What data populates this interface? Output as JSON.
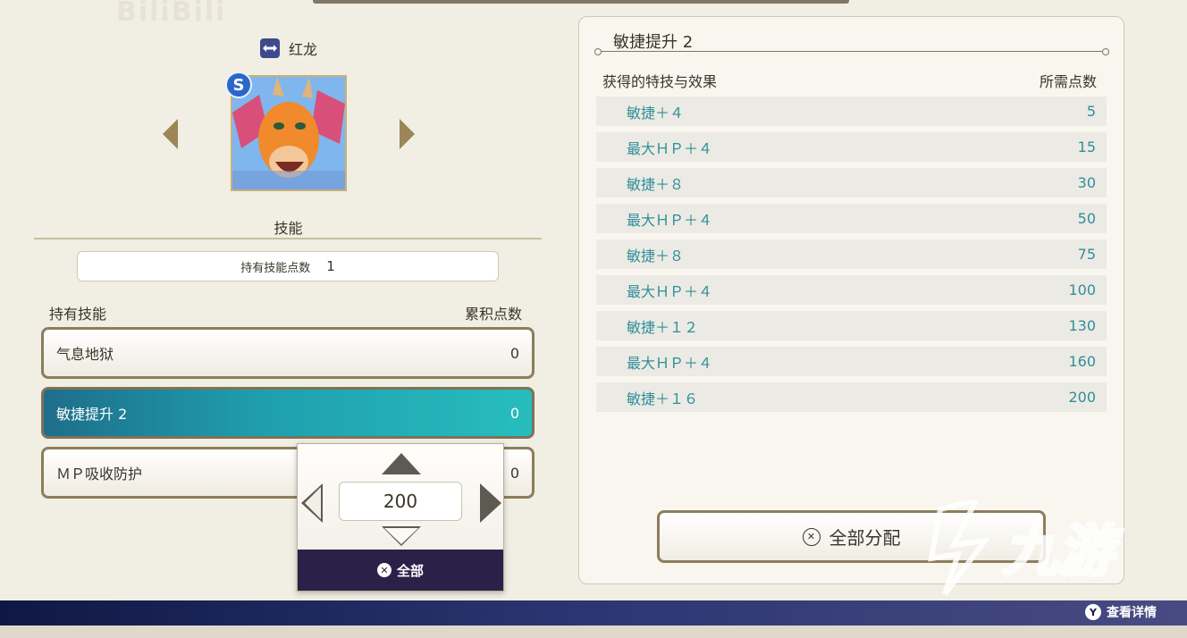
{
  "watermark_top": "BiliBili",
  "character": {
    "name": "红龙",
    "rank": "S"
  },
  "skills_section": {
    "heading": "技能",
    "points_label": "持有技能点数",
    "points_value": "1",
    "list_header_left": "持有技能",
    "list_header_right": "累积点数",
    "skills": [
      {
        "name": "气息地狱",
        "points": "0"
      },
      {
        "name": "敏捷提升 2",
        "points": "0"
      },
      {
        "name": "ＭＰ吸收防护",
        "points": "0"
      }
    ]
  },
  "quantity_popup": {
    "value": "200",
    "all_label": "全部",
    "button_glyph": "✕"
  },
  "detail_panel": {
    "title": "敏捷提升 2",
    "header_left": "获得的特技与效果",
    "header_right": "所需点数",
    "effects": [
      {
        "effect": "敏捷＋４",
        "cost": "5"
      },
      {
        "effect": "最大ＨＰ＋４",
        "cost": "15"
      },
      {
        "effect": "敏捷＋８",
        "cost": "30"
      },
      {
        "effect": "最大ＨＰ＋４",
        "cost": "50"
      },
      {
        "effect": "敏捷＋８",
        "cost": "75"
      },
      {
        "effect": "最大ＨＰ＋４",
        "cost": "100"
      },
      {
        "effect": "敏捷＋１２",
        "cost": "130"
      },
      {
        "effect": "最大ＨＰ＋４",
        "cost": "160"
      },
      {
        "effect": "敏捷＋１６",
        "cost": "200"
      }
    ],
    "assign_all_label": "全部分配",
    "assign_glyph": "✕"
  },
  "footer": {
    "hint_button": "Y",
    "hint_label": "查看详情"
  },
  "site_watermark": "九游",
  "colors": {
    "accent_teal": "#1f9fae",
    "effect_text": "#2f8f9a",
    "footer_bg": "#0f1844"
  },
  "icons": [
    "swap-icon",
    "arrow-left-icon",
    "arrow-right-icon",
    "up-arrow-icon",
    "down-arrow-icon",
    "decrease-icon",
    "increase-icon"
  ]
}
